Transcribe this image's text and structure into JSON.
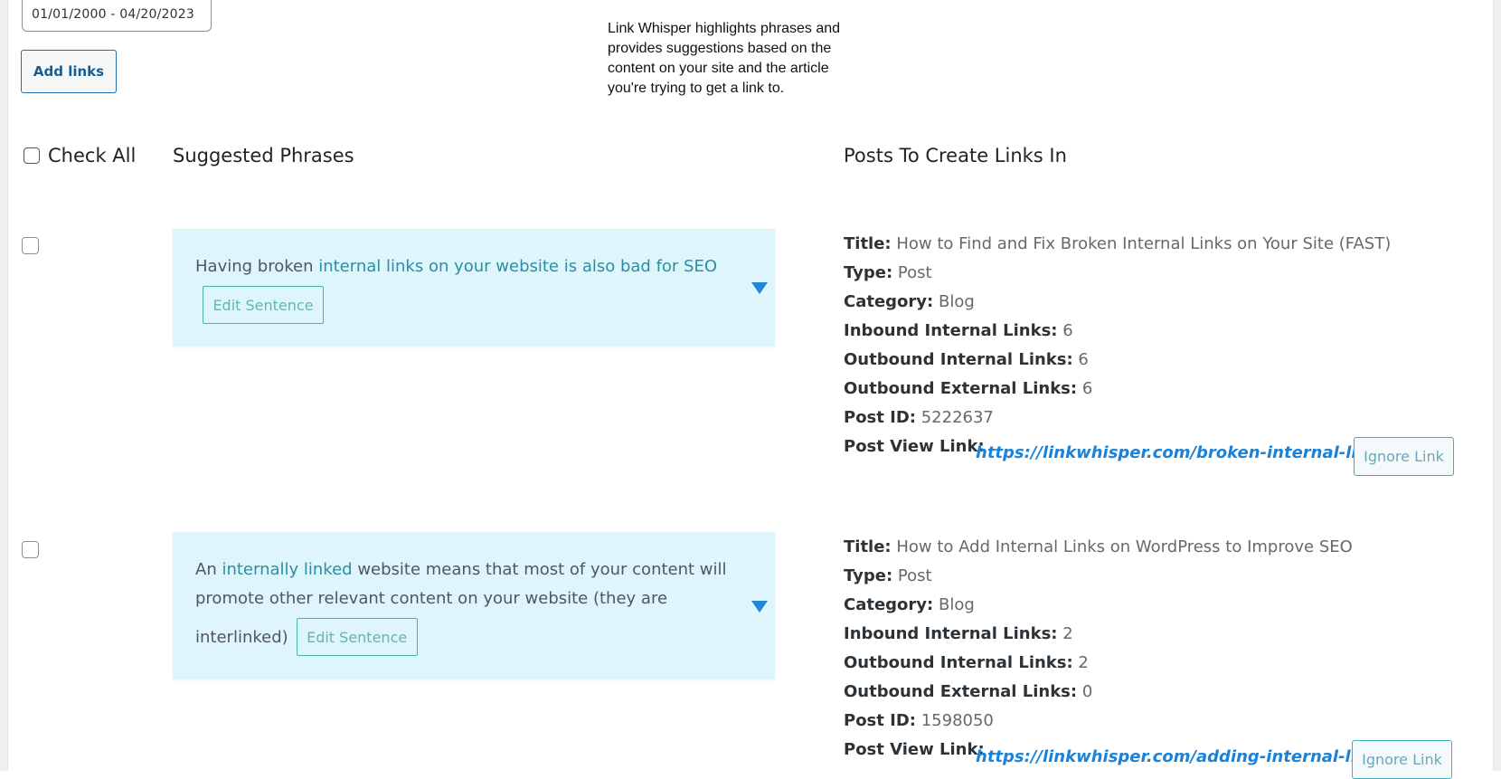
{
  "filters": {
    "date_range": "01/01/2000 - 04/20/2023",
    "add_links_label": "Add links"
  },
  "help_text": "Link Whisper highlights phrases and provides suggestions based on the content on your site and the article you're trying to get a link to.",
  "header": {
    "check_all_label": "Check All",
    "suggested_phrases": "Suggested Phrases",
    "posts_to_create_links_in": "Posts To Create Links In"
  },
  "labels": {
    "title": "Title:",
    "type": "Type:",
    "category": "Category:",
    "inbound_internal": "Inbound Internal Links:",
    "outbound_internal": "Outbound Internal Links:",
    "outbound_external": "Outbound External Links:",
    "post_id": "Post ID:",
    "post_view_link": "Post View Link:",
    "edit_sentence": "Edit Sentence",
    "ignore_link": "Ignore Link"
  },
  "rows": [
    {
      "phrase_pre": "Having broken ",
      "phrase_link": "internal links on your website is also bad for SEO",
      "phrase_post": "",
      "post": {
        "title": "How to Find and Fix Broken Internal Links on Your Site (FAST)",
        "type": "Post",
        "category": "Blog",
        "inbound_internal": "6",
        "outbound_internal": "6",
        "outbound_external": "6",
        "post_id": "5222637",
        "url": "https://linkwhisper.com/broken-internal-links/"
      }
    },
    {
      "phrase_pre": "An ",
      "phrase_link": "internally linked",
      "phrase_post_line1": " website means that most of your content will",
      "phrase_post_line2": "promote other relevant content on your website (they are",
      "phrase_post_line3": "interlinked)",
      "post": {
        "title": "How to Add Internal Links on WordPress to Improve SEO",
        "type": "Post",
        "category": "Blog",
        "inbound_internal": "2",
        "outbound_internal": "2",
        "outbound_external": "0",
        "post_id": "1598050",
        "url": "https://linkwhisper.com/adding-internal-links/"
      }
    }
  ],
  "colors": {
    "accent": "#2271b1",
    "phrase_bg": "#dff5fc",
    "link_highlight": "#2a8fa1",
    "url_blue": "#1a82d8",
    "triangle_blue": "#1e88d6"
  }
}
